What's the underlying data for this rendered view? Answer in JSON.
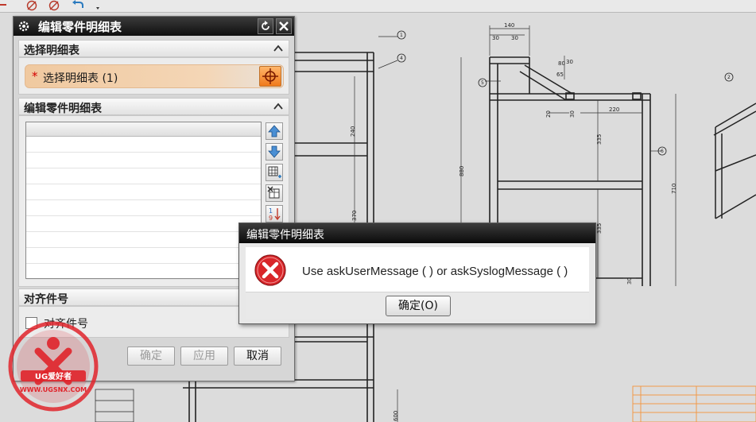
{
  "dialog": {
    "title": "编辑零件明细表",
    "section_select": "选择明细表",
    "select_row_star": "*",
    "select_row_label": "选择明细表 (1)",
    "section_edit": "编辑零件明细表",
    "section_align": "对齐件号",
    "align_checkbox_label": "对齐件号",
    "align_checked": false,
    "ok_label": "确定",
    "apply_label": "应用",
    "cancel_label": "取消",
    "sort_label_top": "1",
    "sort_label_bottom": "9"
  },
  "message_box": {
    "title": "编辑零件明细表",
    "text": "Use askUserMessage ( ) or askSyslogMessage ( )",
    "ok_label": "确定(O)",
    "icon": "error-icon"
  },
  "drawing": {
    "dims": [
      "140",
      "30",
      "30",
      "80",
      "30",
      "65",
      "240",
      "370",
      "880",
      "220",
      "335",
      "335",
      "710",
      "20",
      "30",
      "30",
      "600"
    ],
    "balloons": [
      "1",
      "4",
      "5",
      "2",
      "6"
    ]
  },
  "watermark": {
    "name": "UG爱好者",
    "url": "WWW.UGSNX.COM"
  },
  "colors": {
    "title_bar": "#111111",
    "select_row": "#f2cca4",
    "select_button": "#f28a2a",
    "error_red": "#d9262a",
    "drawing_line": "#222222",
    "title_block": "#f29a4a"
  }
}
